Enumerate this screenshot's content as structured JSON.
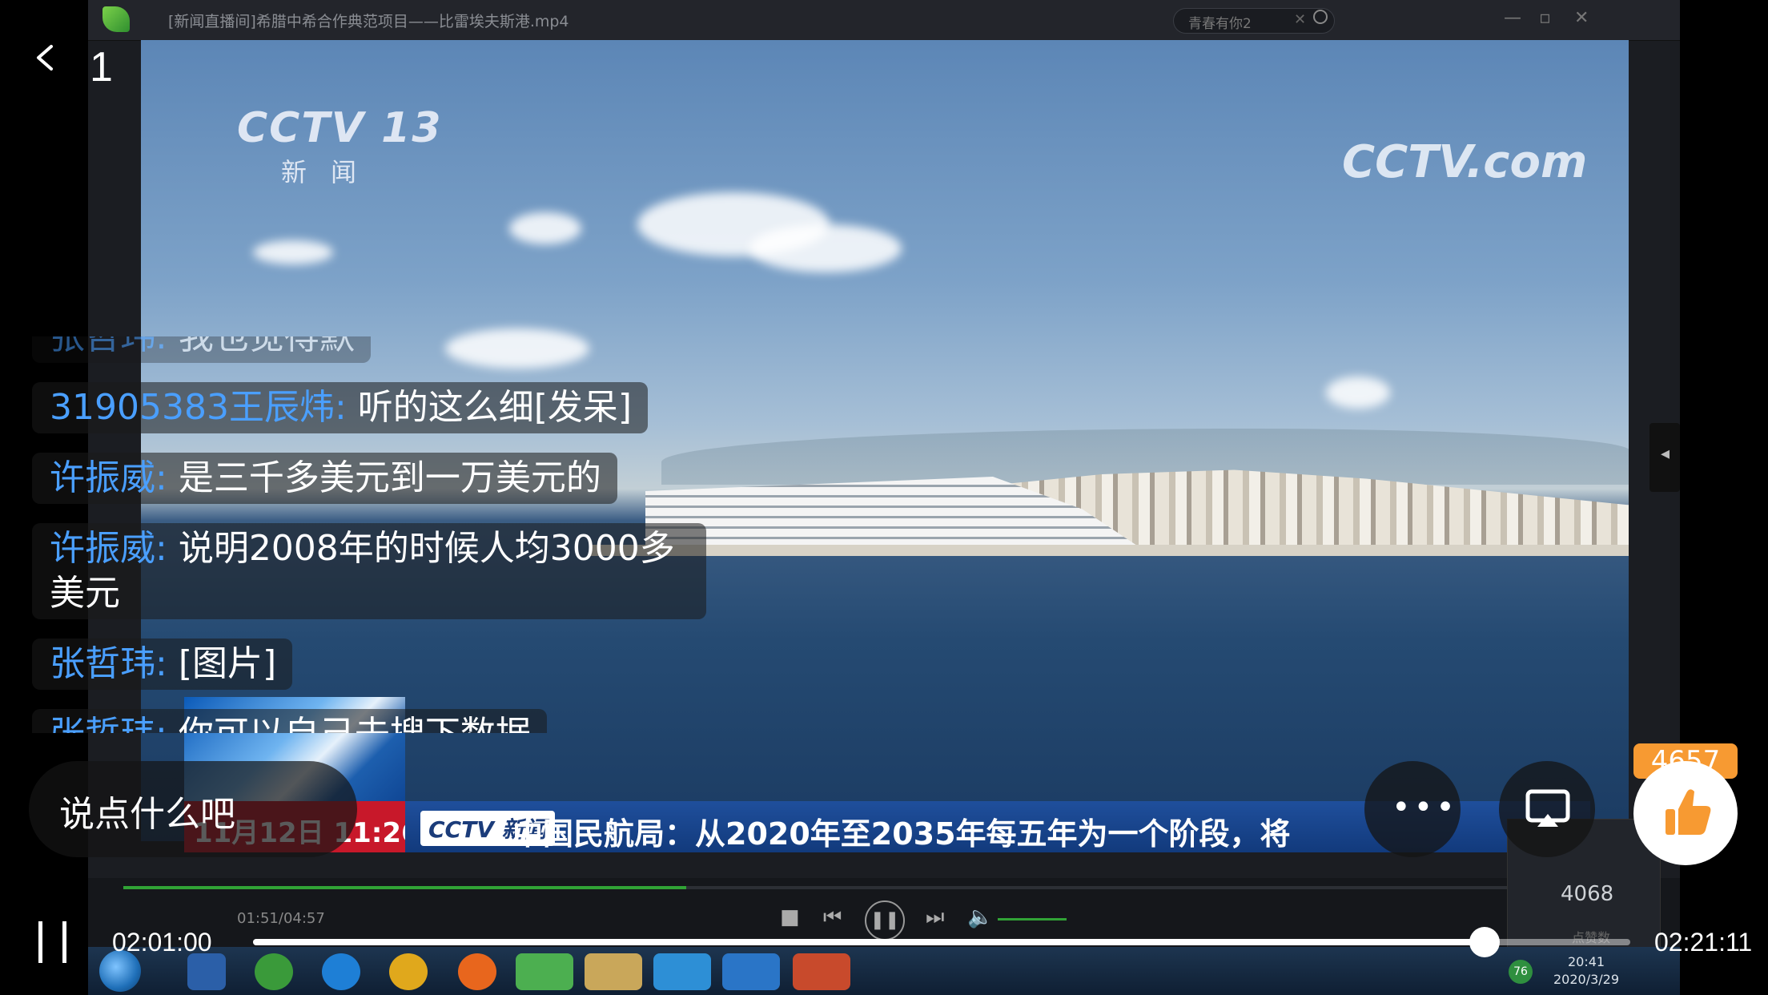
{
  "header": {
    "page_indicator": "1"
  },
  "screen_share": {
    "window_title": "[新闻直播间]希腊中希合作典范项目——比雷埃夫斯港.mp4",
    "search_value": "青春有你2",
    "video_overlay": {
      "channel_logo": "CCTV 13",
      "channel_sub": "新闻",
      "watermark": "CCTV.com"
    },
    "ticker": {
      "date": "11月12日 11:26",
      "logo": "CCTV 新闻",
      "text": "中国民航局：从2020年至2035年每五年为一个阶段，将"
    },
    "side_panel_number": "4068",
    "side_panel_sub": "点赞数",
    "player_time": "01:51/04:57",
    "player_progress": 0.37,
    "taskbar": {
      "clock_time": "20:41",
      "clock_date": "2020/3/29",
      "temperature": "76"
    }
  },
  "chat": {
    "messages": [
      {
        "name": "张哲玮:",
        "text": " 我也觉得默"
      },
      {
        "name": "31905383王辰炜:",
        "text": " 听的这么细[发呆]"
      },
      {
        "name": "许振威:",
        "text": " 是三千多美元到一万美元的"
      },
      {
        "name": "许振威:",
        "text": " 说明2008年的时候人均3000多美元"
      },
      {
        "name": "张哲玮:",
        "text": " [图片]"
      },
      {
        "name": "张哲玮:",
        "text": " 你可以自己去搜下数据"
      }
    ]
  },
  "comment_box": {
    "placeholder": "说点什么吧"
  },
  "like": {
    "count": "4657"
  },
  "playback": {
    "current_time": "02:01:00",
    "total_time": "02:21:11",
    "progress": 0.894
  },
  "colors": {
    "accent_blue": "#4a9fff",
    "like_orange": "#f79a32",
    "player_green": "#31a336"
  }
}
